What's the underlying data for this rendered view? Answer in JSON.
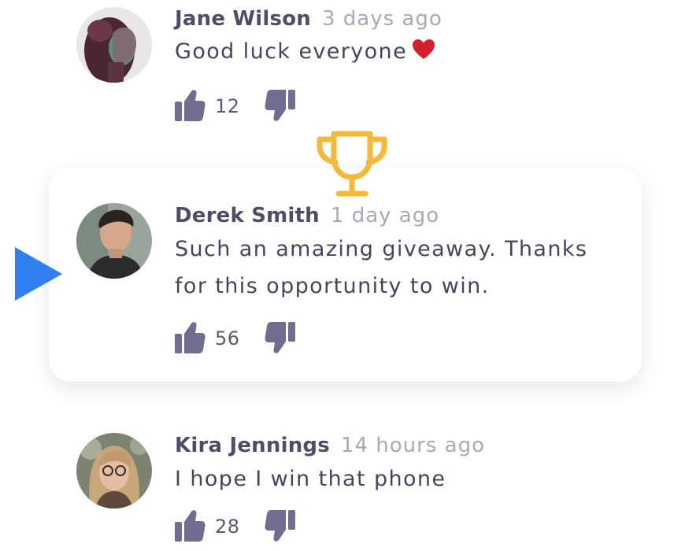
{
  "colors": {
    "accent_blue": "#2f7ff0",
    "trophy_gold": "#f3b93b",
    "icon_slate": "#6f6e90",
    "author_text": "#4e4d68",
    "time_text": "#a9a8b8",
    "heart_red": "#d61f2c"
  },
  "comments": [
    {
      "author": "Jane Wilson",
      "time": "3 days ago",
      "text_lines": [
        "Good luck everyone"
      ],
      "emoji": "heart-icon",
      "likes": "12",
      "highlighted": false
    },
    {
      "author": "Derek Smith",
      "time": "1 day ago",
      "text_lines": [
        "Such an amazing giveaway. Thanks",
        "for this opportunity to win."
      ],
      "likes": "56",
      "highlighted": true,
      "badge_icon": "trophy-icon",
      "marker_icon": "play-arrow-icon"
    },
    {
      "author": "Kira Jennings",
      "time": "14 hours ago",
      "text_lines": [
        "I hope I win that phone"
      ],
      "likes": "28",
      "highlighted": false
    }
  ]
}
